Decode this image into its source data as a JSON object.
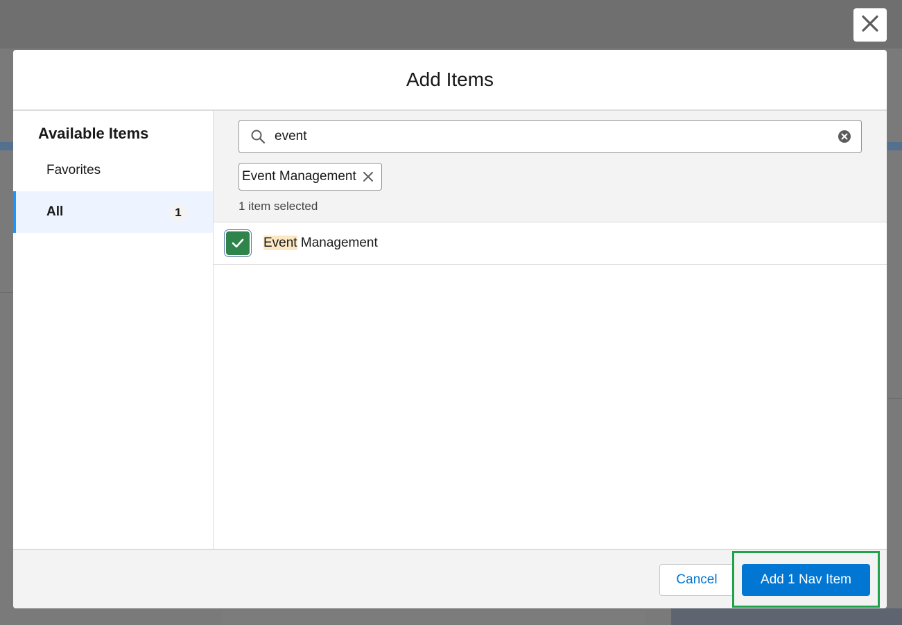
{
  "modal": {
    "title": "Add Items",
    "close_icon": "close-icon"
  },
  "sidebar": {
    "heading": "Available Items",
    "items": [
      {
        "label": "Favorites",
        "active": false
      },
      {
        "label": "All",
        "count": "1",
        "active": true
      }
    ]
  },
  "search": {
    "value": "event",
    "placeholder": "",
    "icon": "search-icon",
    "clear_icon": "clear-icon"
  },
  "selected": {
    "pills": [
      {
        "label": "Event Management"
      }
    ],
    "count_text": "1 item selected"
  },
  "results": [
    {
      "match": "Event",
      "rest": " Management",
      "checked": true
    }
  ],
  "footer": {
    "cancel_label": "Cancel",
    "primary_label": "Add 1 Nav Item"
  },
  "colors": {
    "brand": "#0176d3",
    "checkbox_checked": "#2e844a",
    "highlight": "#fbe8c2",
    "active_indicator": "#1b96ff",
    "focus_outline": "#1fa24a"
  }
}
